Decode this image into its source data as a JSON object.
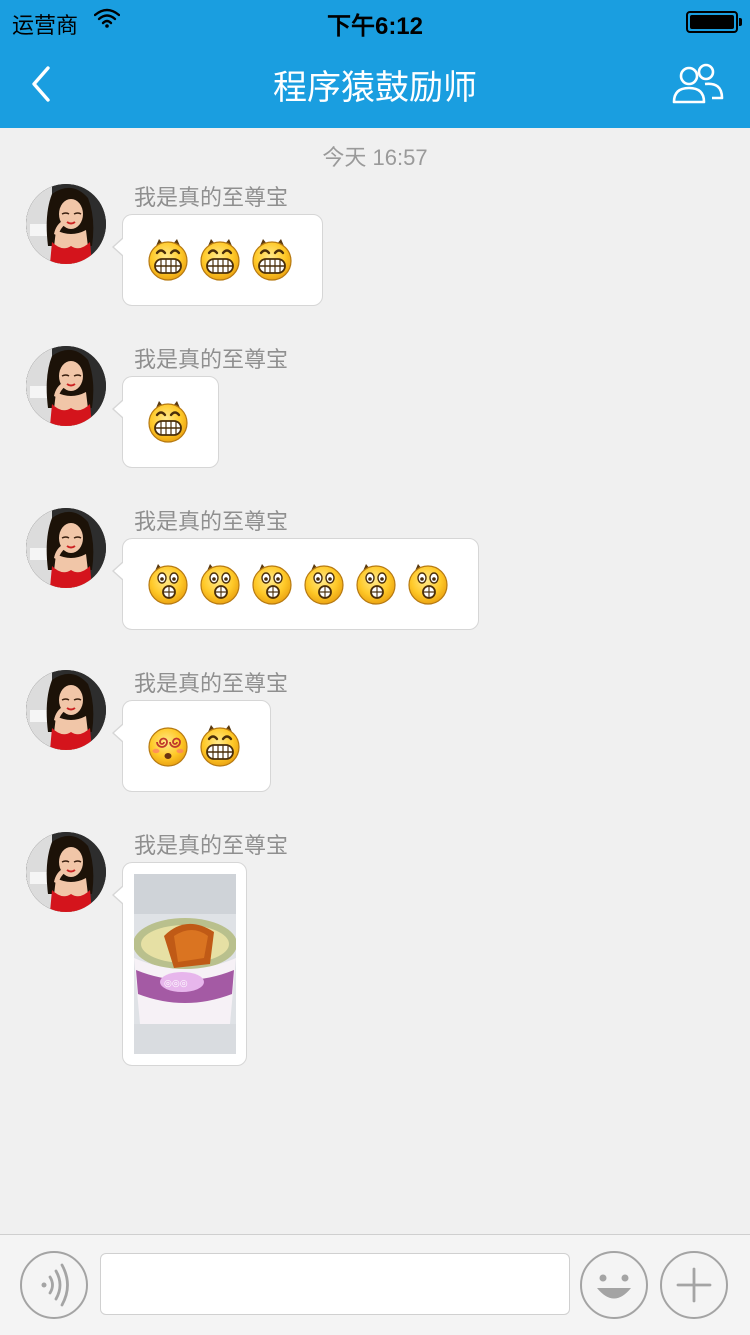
{
  "status_bar": {
    "carrier": "运营商",
    "time": "下午6:12"
  },
  "nav": {
    "title": "程序猿鼓励师"
  },
  "chat": {
    "timestamp": "今天  16:57",
    "messages": [
      {
        "sender": "我是真的至尊宝",
        "type": "emoji",
        "emojis": [
          "grin",
          "grin",
          "grin"
        ]
      },
      {
        "sender": "我是真的至尊宝",
        "type": "emoji",
        "emojis": [
          "grin"
        ]
      },
      {
        "sender": "我是真的至尊宝",
        "type": "emoji",
        "emojis": [
          "scared",
          "scared",
          "scared",
          "scared",
          "scared",
          "scared"
        ]
      },
      {
        "sender": "我是真的至尊宝",
        "type": "emoji",
        "emojis": [
          "dizzy",
          "grin"
        ]
      },
      {
        "sender": "我是真的至尊宝",
        "type": "image",
        "image": "noodle-cup-photo"
      }
    ]
  },
  "input_bar": {
    "value": "",
    "placeholder": ""
  },
  "colors": {
    "nav_bar": "#1a9ee0",
    "background": "#f0f0f0",
    "bubble": "#ffffff",
    "sender_text": "#8f8f8f"
  }
}
